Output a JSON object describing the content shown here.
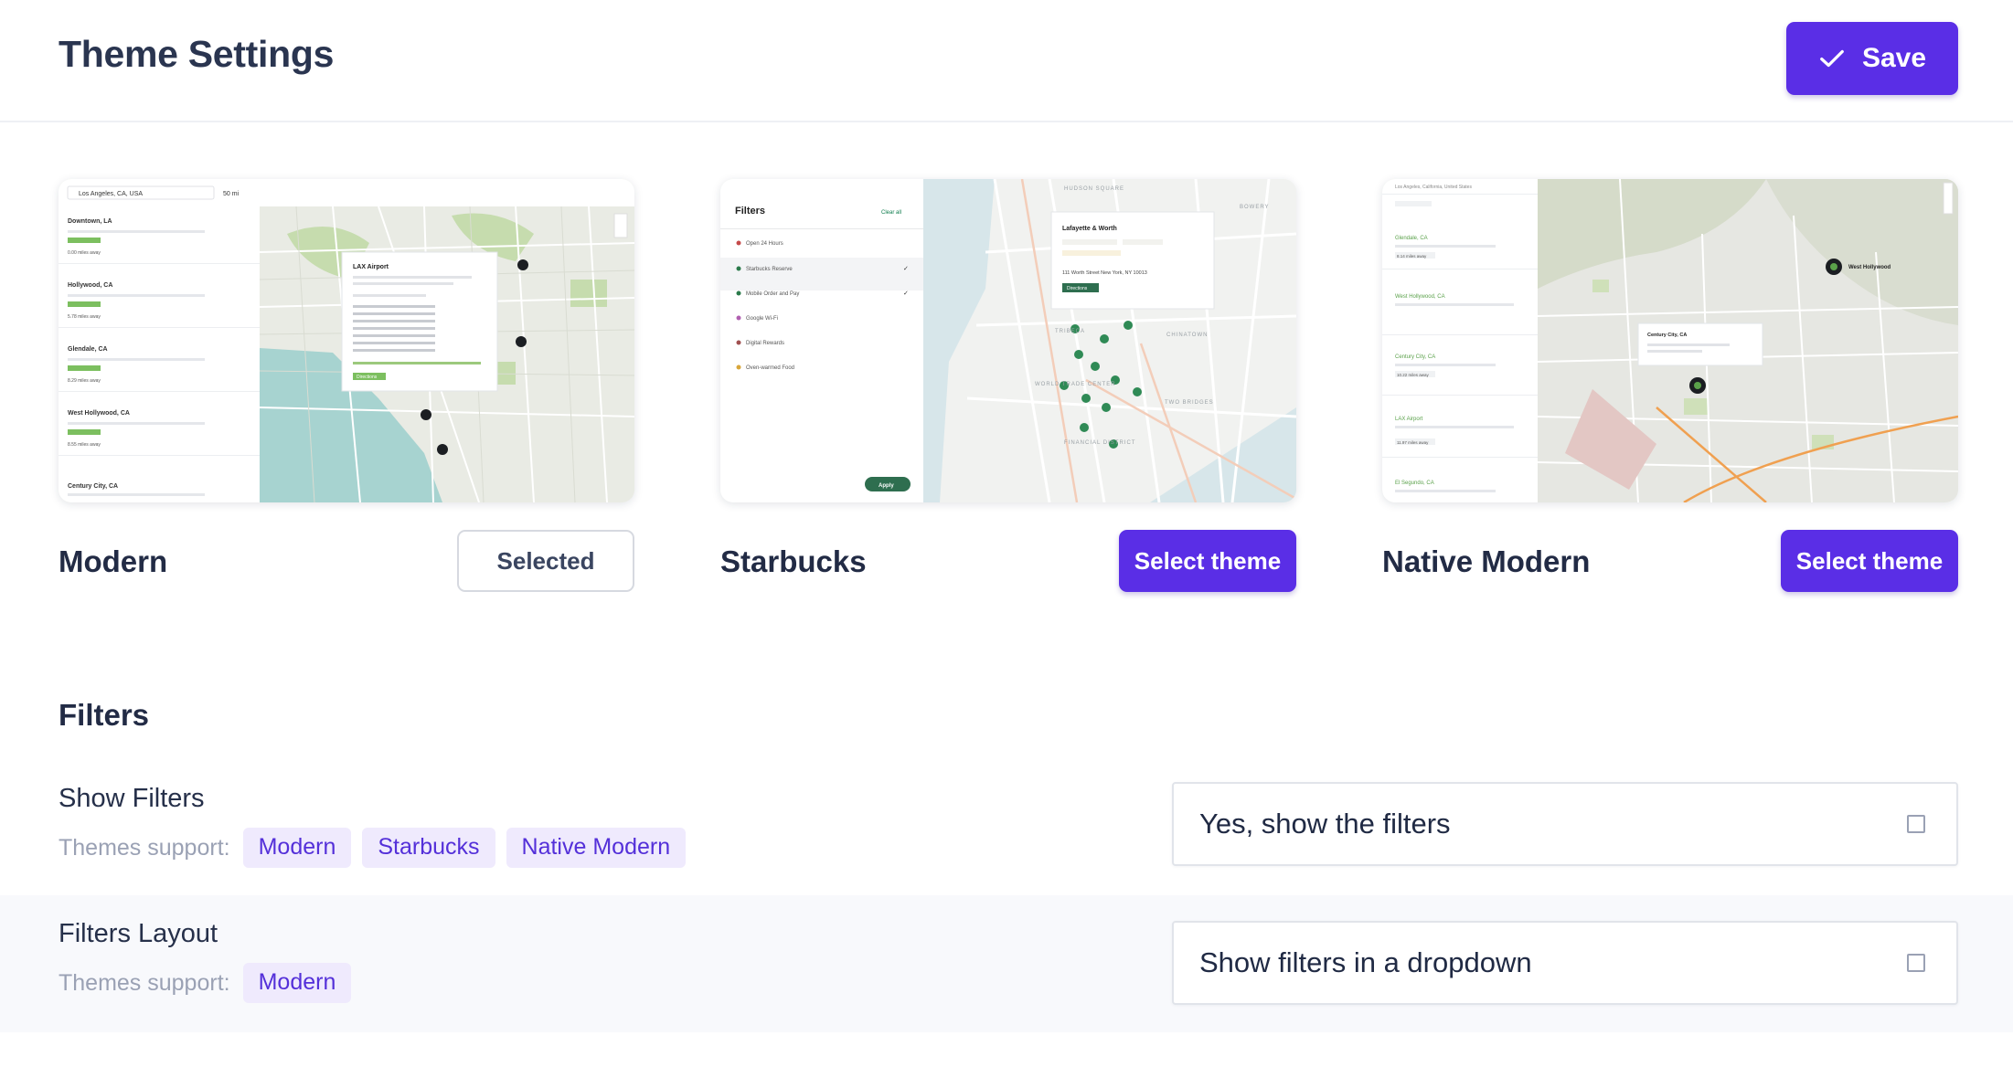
{
  "header": {
    "title": "Theme Settings",
    "save_label": "Save",
    "save_icon": "check-icon"
  },
  "themes": [
    {
      "name": "Modern",
      "button_label": "Selected",
      "selected": true,
      "preview": {
        "search_text": "Los Angeles, CA, USA",
        "radius_text": "50 mi",
        "locations": [
          {
            "name": "Downtown, LA",
            "distance": "0.00 miles away"
          },
          {
            "name": "Hollywood, CA",
            "distance": "5.78 miles away"
          },
          {
            "name": "Glendale, CA",
            "distance": "8.29 miles away"
          },
          {
            "name": "West Hollywood, CA",
            "distance": "8.55 miles away"
          },
          {
            "name": "Century City, CA",
            "distance": ""
          }
        ],
        "popup_title": "LAX Airport",
        "popup_button": "Directions"
      }
    },
    {
      "name": "Starbucks",
      "button_label": "Select theme",
      "selected": false,
      "preview": {
        "filters_title": "Filters",
        "clear_all": "Clear all",
        "filter_items": [
          "Open 24 Hours",
          "Starbucks Reserve",
          "Mobile Order and Pay",
          "Google Wi-Fi",
          "Digital Rewards",
          "Oven-warmed Food"
        ],
        "apply_label": "Apply",
        "popup_title": "Lafayette & Worth",
        "popup_address": "111 Worth Street New York, NY 10013",
        "popup_button": "Directions",
        "map_labels": [
          "HUDSON SQUARE",
          "BOWERY",
          "CHINATOWN",
          "TRIBECA",
          "WORLD TRADE CENTER",
          "TWO BRIDGES",
          "FINANCIAL DISTRICT"
        ]
      }
    },
    {
      "name": "Native Modern",
      "button_label": "Select theme",
      "selected": false,
      "preview": {
        "search_text": "Los Angeles, California, United States",
        "locations": [
          {
            "name": "Glendale, CA",
            "distance": "8.14 miles away"
          },
          {
            "name": "West Hollywood, CA",
            "distance": ""
          },
          {
            "name": "Century City, CA",
            "distance": "10.22 miles away"
          },
          {
            "name": "LAX Airport",
            "distance": "11.97 miles away"
          },
          {
            "name": "El Segundo, CA",
            "distance": ""
          }
        ],
        "popup_title": "Century City, CA",
        "map_label": "West Hollywood"
      }
    }
  ],
  "filters_section": {
    "title": "Filters",
    "settings": [
      {
        "label": "Show Filters",
        "support_label": "Themes support:",
        "tags": [
          "Modern",
          "Starbucks",
          "Native Modern"
        ],
        "value": "Yes, show the filters",
        "checked": false
      },
      {
        "label": "Filters Layout",
        "support_label": "Themes support:",
        "tags": [
          "Modern"
        ],
        "value": "Show filters in a dropdown",
        "checked": false
      }
    ]
  },
  "colors": {
    "accent": "#5a2ee6",
    "tag_bg": "#efeafd",
    "tag_text": "#5430d9",
    "title": "#2a3550"
  }
}
